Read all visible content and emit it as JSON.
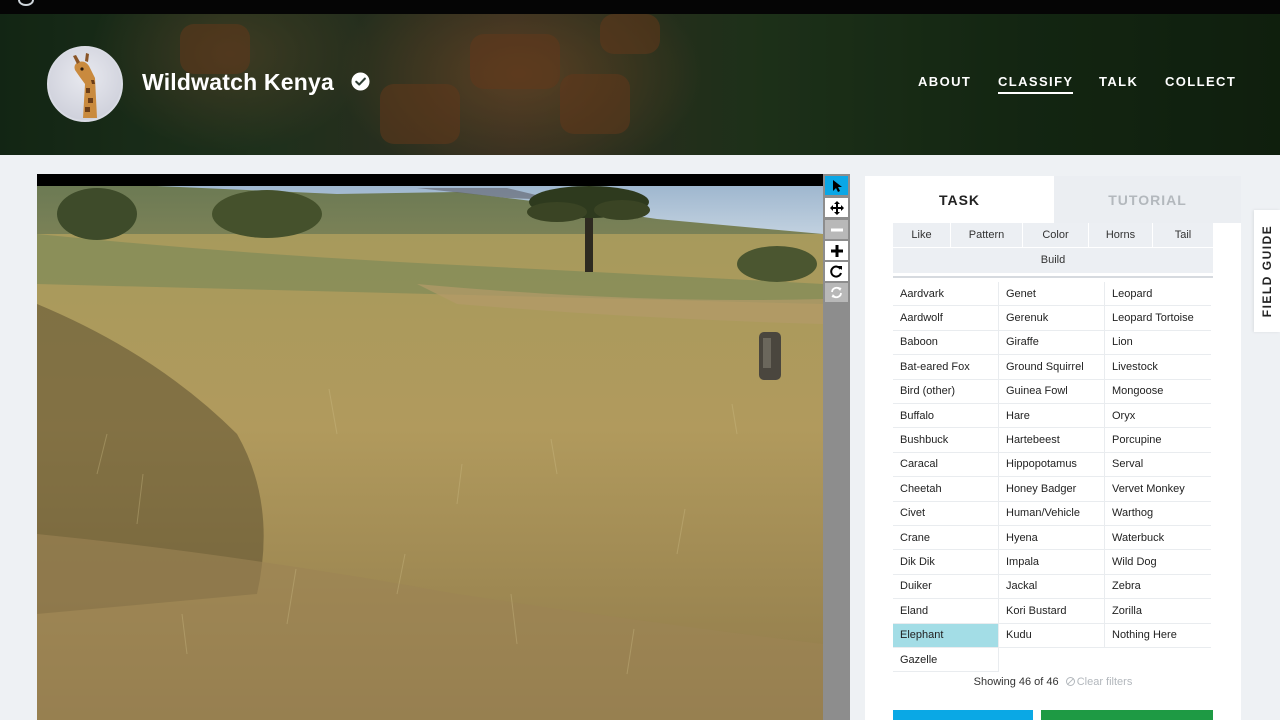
{
  "header": {
    "project_title": "Wildwatch Kenya",
    "nav": [
      {
        "label": "ABOUT",
        "active": false
      },
      {
        "label": "CLASSIFY",
        "active": true
      },
      {
        "label": "TALK",
        "active": false
      },
      {
        "label": "COLLECT",
        "active": false
      }
    ]
  },
  "viewer": {
    "tools": [
      "pointer-icon",
      "move-icon",
      "zoom-out-icon",
      "zoom-in-icon",
      "rotate-icon",
      "reset-icon"
    ],
    "active_tool": "pointer-icon"
  },
  "panel": {
    "tabs": {
      "task": "TASK",
      "tutorial": "TUTORIAL"
    },
    "filters": [
      "Like",
      "Pattern",
      "Color",
      "Horns",
      "Tail",
      "Build"
    ],
    "choices": [
      [
        "Aardvark",
        "Aardwolf",
        "Baboon",
        "Bat-eared Fox",
        "Bird (other)",
        "Buffalo",
        "Bushbuck",
        "Caracal",
        "Cheetah",
        "Civet",
        "Crane",
        "Dik Dik",
        "Duiker",
        "Eland",
        "Elephant",
        "Gazelle"
      ],
      [
        "Genet",
        "Gerenuk",
        "Giraffe",
        "Ground Squirrel",
        "Guinea Fowl",
        "Hare",
        "Hartebeest",
        "Hippopotamus",
        "Honey Badger",
        "Human/Vehicle",
        "Hyena",
        "Impala",
        "Jackal",
        "Kori Bustard",
        "Kudu"
      ],
      [
        "Leopard",
        "Leopard Tortoise",
        "Lion",
        "Livestock",
        "Mongoose",
        "Oryx",
        "Porcupine",
        "Serval",
        "Vervet Monkey",
        "Warthog",
        "Waterbuck",
        "Wild Dog",
        "Zebra",
        "Zorilla",
        "Nothing Here"
      ]
    ],
    "selected_choice": "Elephant",
    "showing_text": "Showing 46 of 46",
    "clear_filters": "Clear filters"
  },
  "field_guide": {
    "label": "FIELD GUIDE"
  },
  "colors": {
    "accent_blue": "#0aa8e5",
    "accent_green": "#1e9a44",
    "selected_choice": "#a3dde6"
  }
}
